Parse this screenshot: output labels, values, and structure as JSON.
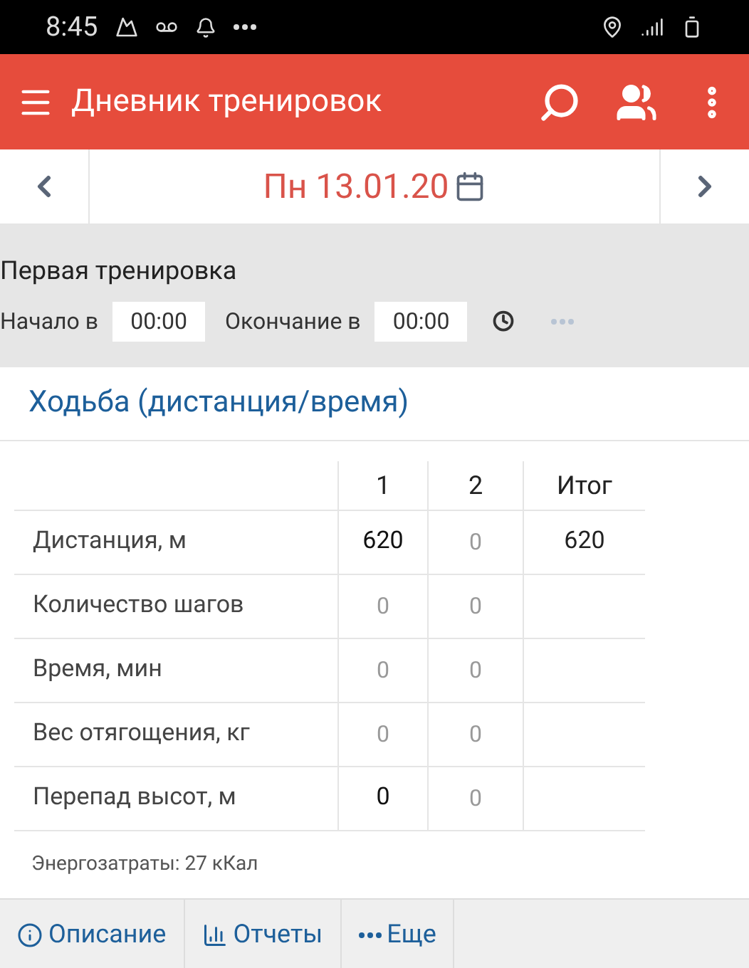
{
  "status_bar": {
    "time": "8:45"
  },
  "app_bar": {
    "title": "Дневник тренировок"
  },
  "date_nav": {
    "date": "Пн 13.01.20"
  },
  "workout": {
    "title": "Первая тренировка",
    "start_label": "Начало в",
    "start_value": "00:00",
    "end_label": "Окончание в",
    "end_value": "00:00"
  },
  "exercise": {
    "title": "Ходьба (дистанция/время)",
    "columns": [
      "1",
      "2",
      "Итог"
    ],
    "rows": [
      {
        "label": "Дистанция, м",
        "cells": [
          {
            "text": "620",
            "filled": true
          },
          {
            "text": "0",
            "filled": false
          }
        ],
        "total": "620"
      },
      {
        "label": "Количество шагов",
        "cells": [
          {
            "text": "0",
            "filled": false
          },
          {
            "text": "0",
            "filled": false
          }
        ]
      },
      {
        "label": "Время, мин",
        "cells": [
          {
            "text": "0",
            "filled": false
          },
          {
            "text": "0",
            "filled": false
          }
        ]
      },
      {
        "label": "Вес отягощения, кг",
        "cells": [
          {
            "text": "0",
            "filled": false
          },
          {
            "text": "0",
            "filled": false
          }
        ]
      },
      {
        "label": "Перепад высот, м",
        "cells": [
          {
            "text": "0",
            "filled": true
          },
          {
            "text": "0",
            "filled": false
          }
        ]
      }
    ],
    "energy": "Энергозатраты: 27 кКал"
  },
  "bottom_bar": [
    {
      "kind": "info",
      "label": "Описание"
    },
    {
      "kind": "chart",
      "label": "Отчеты"
    },
    {
      "kind": "more",
      "label": "Еще"
    }
  ]
}
